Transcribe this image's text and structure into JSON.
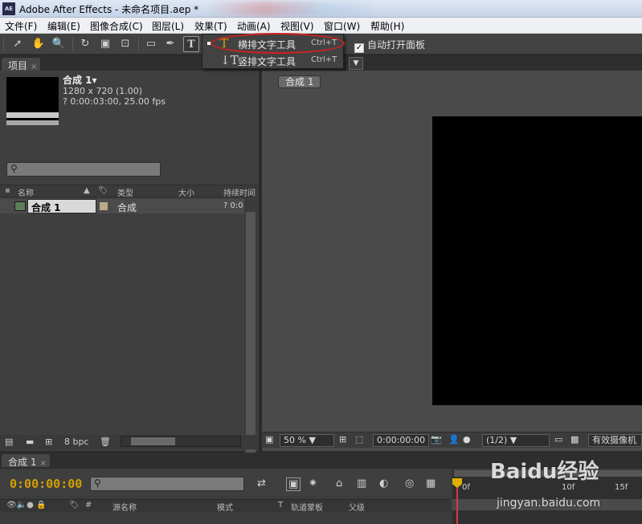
{
  "window": {
    "title": "Adobe After Effects - 未命名项目.aep *",
    "app_icon": "AE"
  },
  "menubar": {
    "items": [
      "文件(F)",
      "编辑(E)",
      "图像合成(C)",
      "图层(L)",
      "效果(T)",
      "动画(A)",
      "视图(V)",
      "窗口(W)",
      "帮助(H)"
    ]
  },
  "toolbar": {
    "auto_open_label": "自动打开面板",
    "auto_open_checked": true,
    "active_tool_glyph": "T"
  },
  "text_tool_menu": {
    "items": [
      {
        "label": "横排文字工具",
        "shortcut": "Ctrl+T",
        "selected": true
      },
      {
        "label": "竖排文字工具",
        "shortcut": "Ctrl+T",
        "selected": false
      }
    ]
  },
  "project": {
    "tab_label": "项目",
    "comp": {
      "name": "合成 1▾",
      "size": "1280 x 720 (1.00)",
      "duration": "? 0:00:03:00, 25.00 fps"
    },
    "columns": {
      "name": "名称",
      "type": "类型",
      "size": "大小",
      "duration": "持续时间"
    },
    "rows": [
      {
        "name": "合成 1",
        "type": "合成",
        "duration": "? 0:0"
      }
    ],
    "footer": {
      "bpc": "8 bpc"
    }
  },
  "composition": {
    "tab_label": "合成 1",
    "zoom": "50 %",
    "timecode": "0:00:00:00",
    "resolution": "(1/2)",
    "camera": "有效摄像机"
  },
  "timeline": {
    "tab_label": "合成 1",
    "timecode": "0:00:00:00",
    "columns": {
      "num": "#",
      "source": "源名称",
      "mode": "模式",
      "t": "T",
      "trkmat": "轨道蒙板",
      "parent": "父级"
    },
    "ruler_labels": [
      "0f",
      "10f",
      "15f"
    ]
  },
  "watermark": {
    "text": "Baidu经验",
    "url": "jingyan.baidu.com"
  },
  "colors": {
    "accent_timecode": "#d4a000",
    "oval": "#d22020",
    "cti": "#d43c3c"
  }
}
